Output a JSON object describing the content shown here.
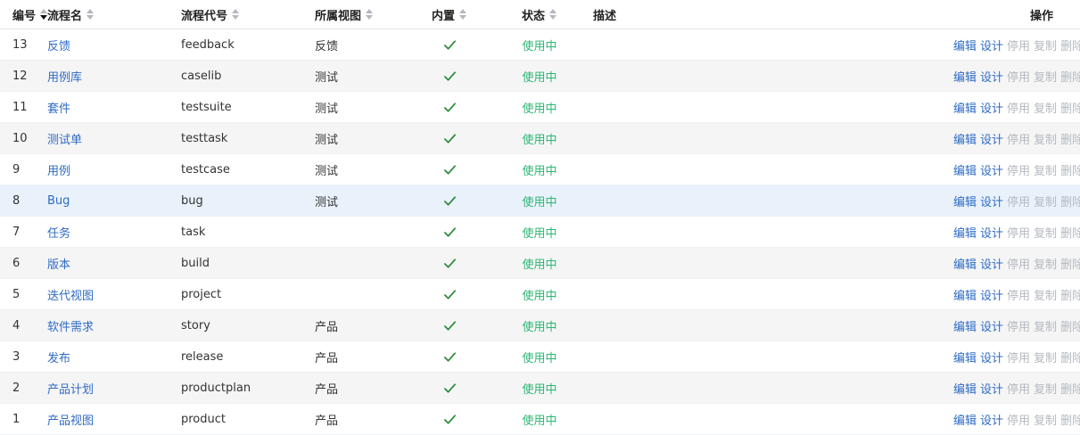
{
  "columns": {
    "id": "编号",
    "name": "流程名",
    "code": "流程代号",
    "view": "所属视图",
    "builtin": "内置",
    "status": "状态",
    "desc": "描述",
    "actions": "操作"
  },
  "sort": {
    "column": "id",
    "direction": "desc"
  },
  "action_labels": {
    "edit": "编辑",
    "design": "设计",
    "disable": "停用",
    "copy": "复制",
    "delete": "删除"
  },
  "colors": {
    "link": "#2e6bc6",
    "status": "#2bb673",
    "check": "#2a8a3a",
    "disabled": "#b5b9bf",
    "row_alt": "#f5f5f5",
    "row_highlight": "#e9f2fb"
  },
  "icons": {
    "builtin": "check-icon",
    "sort": "sort-caret-icon"
  },
  "rows": [
    {
      "id": "13",
      "name": "反馈",
      "code": "feedback",
      "view": "反馈",
      "builtin": true,
      "status": "使用中",
      "desc": ""
    },
    {
      "id": "12",
      "name": "用例库",
      "code": "caselib",
      "view": "测试",
      "builtin": true,
      "status": "使用中",
      "desc": ""
    },
    {
      "id": "11",
      "name": "套件",
      "code": "testsuite",
      "view": "测试",
      "builtin": true,
      "status": "使用中",
      "desc": ""
    },
    {
      "id": "10",
      "name": "测试单",
      "code": "testtask",
      "view": "测试",
      "builtin": true,
      "status": "使用中",
      "desc": ""
    },
    {
      "id": "9",
      "name": "用例",
      "code": "testcase",
      "view": "测试",
      "builtin": true,
      "status": "使用中",
      "desc": ""
    },
    {
      "id": "8",
      "name": "Bug",
      "code": "bug",
      "view": "测试",
      "builtin": true,
      "status": "使用中",
      "desc": "",
      "highlighted": true
    },
    {
      "id": "7",
      "name": "任务",
      "code": "task",
      "view": "",
      "builtin": true,
      "status": "使用中",
      "desc": ""
    },
    {
      "id": "6",
      "name": "版本",
      "code": "build",
      "view": "",
      "builtin": true,
      "status": "使用中",
      "desc": ""
    },
    {
      "id": "5",
      "name": "迭代视图",
      "code": "project",
      "view": "",
      "builtin": true,
      "status": "使用中",
      "desc": ""
    },
    {
      "id": "4",
      "name": "软件需求",
      "code": "story",
      "view": "产品",
      "builtin": true,
      "status": "使用中",
      "desc": ""
    },
    {
      "id": "3",
      "name": "发布",
      "code": "release",
      "view": "产品",
      "builtin": true,
      "status": "使用中",
      "desc": ""
    },
    {
      "id": "2",
      "name": "产品计划",
      "code": "productplan",
      "view": "产品",
      "builtin": true,
      "status": "使用中",
      "desc": ""
    },
    {
      "id": "1",
      "name": "产品视图",
      "code": "product",
      "view": "产品",
      "builtin": true,
      "status": "使用中",
      "desc": ""
    }
  ]
}
